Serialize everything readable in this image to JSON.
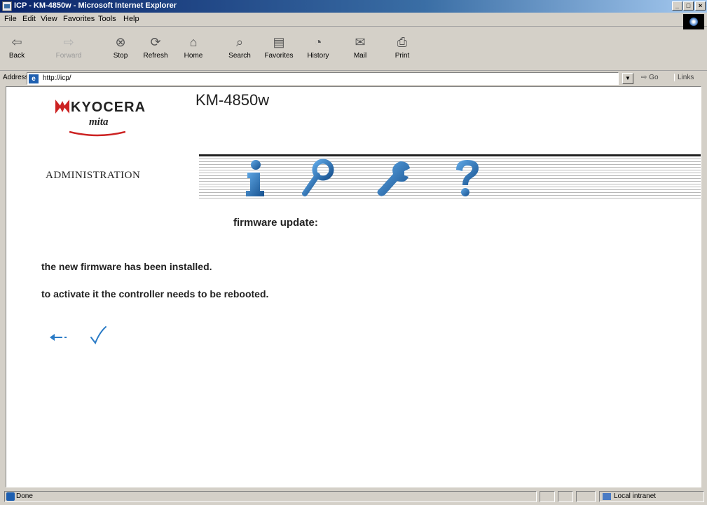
{
  "window": {
    "title": "ICP - KM-4850w - Microsoft Internet Explorer",
    "buttons": [
      "_",
      "□",
      "×"
    ]
  },
  "menu": [
    "File",
    "Edit",
    "View",
    "Favorites",
    "Tools",
    "Help"
  ],
  "toolbar": {
    "back": "Back",
    "forward": "Forward",
    "stop": "Stop",
    "refresh": "Refresh",
    "home": "Home",
    "search": "Search",
    "favorites": "Favorites",
    "history": "History",
    "mail": "Mail",
    "print": "Print"
  },
  "address": {
    "label": "Address",
    "url": "http://icp/",
    "go": "Go",
    "links": "Links"
  },
  "page": {
    "brand": "KYOCERA",
    "brand_sub": "mita",
    "model": "KM-4850w",
    "admin_label": "ADMINISTRATION",
    "section_title": "firmware update:",
    "message_1": "the new firmware has been installed.",
    "message_2": "to activate it the controller needs to be rebooted.",
    "nav_icons": [
      "info-icon",
      "key-icon",
      "wrench-icon",
      "question-icon"
    ],
    "colors": {
      "icon_blue": "#1f6fb5",
      "brand_red": "#cc2222"
    }
  },
  "status": {
    "text": "Done",
    "zone": "Local intranet"
  }
}
